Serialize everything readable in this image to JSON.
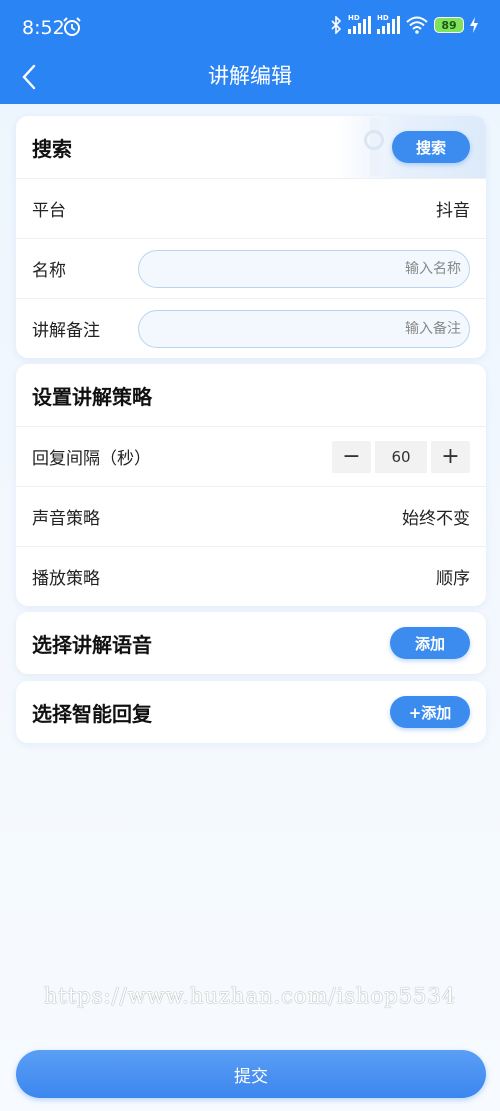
{
  "status_bar": {
    "time": "8:52",
    "battery": "89",
    "hd_label": "HD"
  },
  "header": {
    "title": "讲解编辑"
  },
  "search_card": {
    "title": "搜索",
    "search_button": "搜索",
    "platform_label": "平台",
    "platform_value": "抖音",
    "name_label": "名称",
    "name_placeholder": "输入名称",
    "note_label": "讲解备注",
    "note_placeholder": "输入备注"
  },
  "strategy_card": {
    "title": "设置讲解策略",
    "interval_label": "回复间隔（秒）",
    "interval_value": "60",
    "minus": "−",
    "plus": "+",
    "sound_label": "声音策略",
    "sound_value": "始终不变",
    "play_label": "播放策略",
    "play_value": "顺序"
  },
  "voice_card": {
    "title": "选择讲解语音",
    "add_button": "添加"
  },
  "reply_card": {
    "title": "选择智能回复",
    "add_button": "+添加"
  },
  "watermark": "https://www.huzhan.com/ishop5534",
  "submit_button": "提交",
  "colors": {
    "primary": "#2b84f3",
    "button": "#3c8cf0"
  }
}
